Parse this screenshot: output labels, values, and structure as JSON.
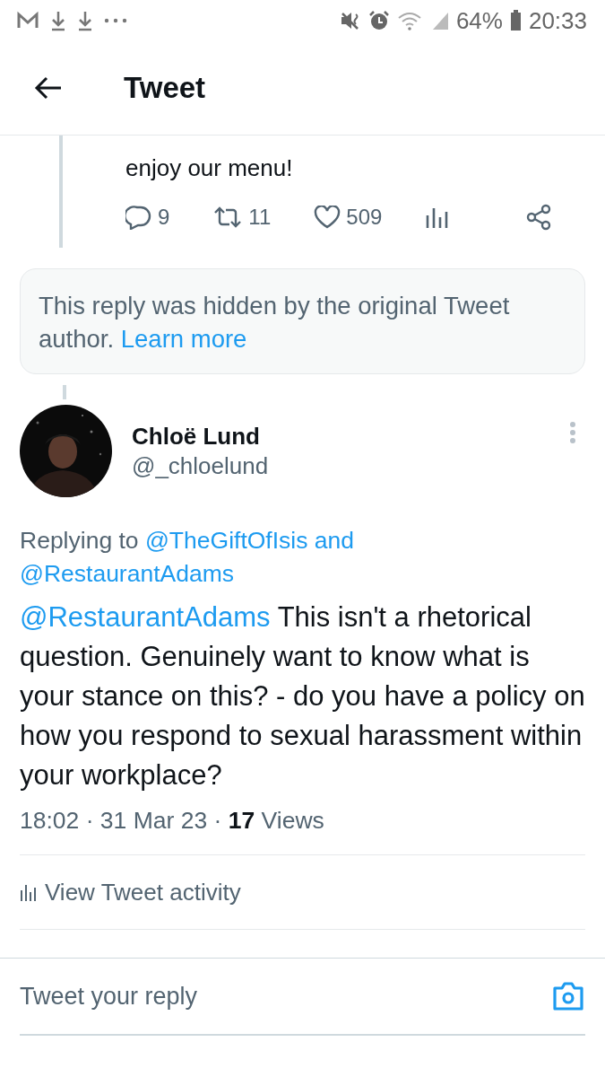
{
  "status_bar": {
    "battery": "64%",
    "time": "20:33"
  },
  "header": {
    "title": "Tweet"
  },
  "parent_tweet": {
    "text_tail": "enjoy our menu!",
    "actions": [
      {
        "kind": "reply",
        "count": "9"
      },
      {
        "kind": "retweet",
        "count": "11"
      },
      {
        "kind": "like",
        "count": "509"
      },
      {
        "kind": "views"
      },
      {
        "kind": "share"
      }
    ]
  },
  "hidden_notice": {
    "text": "This reply was hidden by the original Tweet author.",
    "link": "Learn more"
  },
  "tweet": {
    "name": "Chloë Lund",
    "handle": "@_chloelund",
    "replying_prefix": "Replying to",
    "replying_to": [
      "@TheGiftOfIsis",
      "@RestaurantAdams"
    ],
    "replying_joiner": "and",
    "mention": "@RestaurantAdams",
    "text": "This isn't a rhetorical question. Genuinely want to know what is your stance on this? - do you have a policy on how you respond to sexual harassment within your workplace?",
    "meta": "18:02 · 31 Mar 23 · **17** Views"
  },
  "activity": {
    "label": "View Tweet activity"
  },
  "reply_field": {
    "placeholder": "Tweet your reply"
  }
}
